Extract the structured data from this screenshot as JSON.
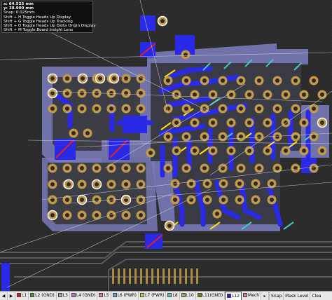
{
  "hud": {
    "x": "x: 64.525 mm",
    "y": "y: 38.900 mm",
    "snap": "Snap: 0.025mm",
    "shortcuts": [
      "Shift + H  Toggle Heads Up Display",
      "Shift + G  Toggle Heads Up Tracking",
      "Shift + D  Toggle Heads Up Delta Origin Display",
      "Shift + M  Toggle Board Insight Lens"
    ]
  },
  "layers": [
    {
      "label": "L1",
      "color": "#d81e1e"
    },
    {
      "label": "L2 (GND)",
      "color": "#3c9a3c"
    },
    {
      "label": "L3",
      "color": "#a0a0a0"
    },
    {
      "label": "L4 (GND)",
      "color": "#c070c0"
    },
    {
      "label": "L5",
      "color": "#e08080"
    },
    {
      "label": "L6 (PWR)",
      "color": "#60a0e0"
    },
    {
      "label": "L7 (PWR)",
      "color": "#d0d040"
    },
    {
      "label": "L8",
      "color": "#60c0c0"
    },
    {
      "label": "L10",
      "color": "#a0a050"
    },
    {
      "label": "L11(GND)",
      "color": "#808000"
    },
    {
      "label": "L12",
      "color": "#2020c8",
      "active": true
    },
    {
      "label": "Mech",
      "color": "#e070b0"
    }
  ],
  "controls": {
    "snap": "Snap",
    "mask": "Mask Level",
    "clear": "Clea"
  },
  "colors": {
    "board": "#262626",
    "copper_fill": "#8a8ac0",
    "trace_blue": "#2a2ae6",
    "pad": "#b08a3c",
    "via_highlight": "#ffffff"
  }
}
